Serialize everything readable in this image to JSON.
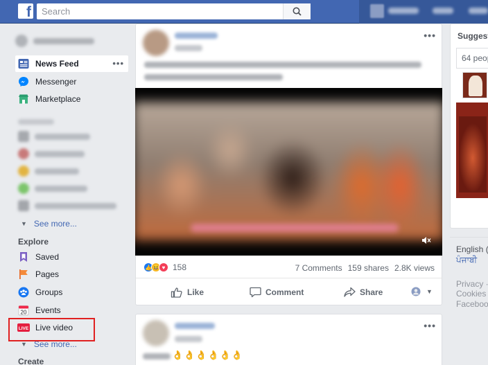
{
  "header": {
    "logo": "f",
    "search_placeholder": "Search"
  },
  "sidebar": {
    "nav": [
      {
        "label": "News Feed",
        "icon": "news-feed-icon"
      },
      {
        "label": "Messenger",
        "icon": "messenger-icon"
      },
      {
        "label": "Marketplace",
        "icon": "marketplace-icon"
      }
    ],
    "more_dots": "•••",
    "shortcuts_see_more": "See more...",
    "explore_heading": "Explore",
    "explore": [
      {
        "label": "Saved",
        "icon": "saved-icon"
      },
      {
        "label": "Pages",
        "icon": "pages-icon"
      },
      {
        "label": "Groups",
        "icon": "groups-icon"
      },
      {
        "label": "Events",
        "icon": "events-icon",
        "badge": "20"
      },
      {
        "label": "Live video",
        "icon": "live-video-icon",
        "badge": "LIVE"
      }
    ],
    "explore_see_more": "See more...",
    "create_heading": "Create"
  },
  "post1": {
    "menu_dots": "•••",
    "reaction_count": "158",
    "comments": "7 Comments",
    "shares": "159 shares",
    "views": "2.8K views",
    "actions": {
      "like": "Like",
      "comment": "Comment",
      "share": "Share"
    }
  },
  "post2": {
    "menu_dots": "•••",
    "emoji_line": "👌👌👌👌👌👌"
  },
  "right": {
    "suggested_title": "Suggest",
    "people_count": "64 peop",
    "lang_english": "English (",
    "lang_punjabi": "ਪੰਜਾਬੀ",
    "footer": [
      "Privacy ·",
      "Cookies",
      "Faceboo"
    ]
  },
  "colors": {
    "brand": "#4267b2",
    "highlight": "#e02020",
    "link": "#4267b2"
  }
}
